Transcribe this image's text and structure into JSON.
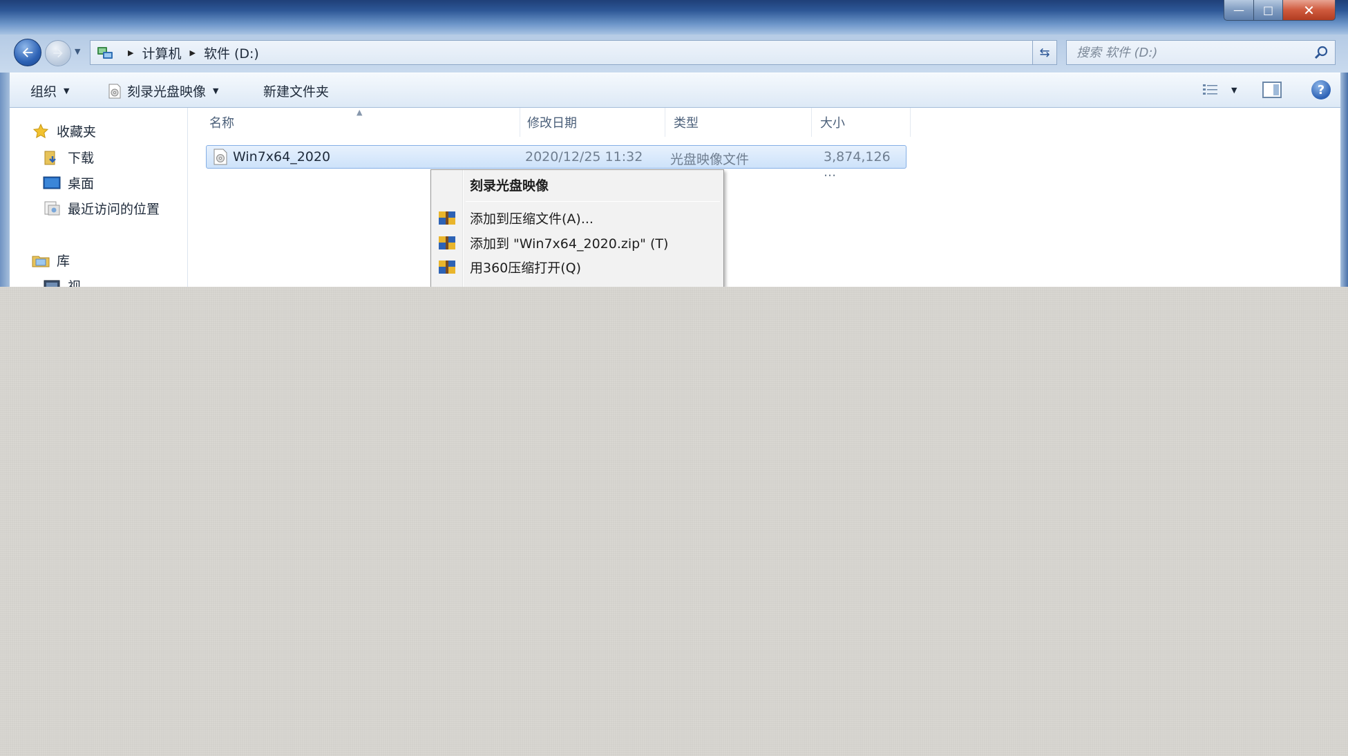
{
  "window": {
    "controls": {
      "minimize": "—",
      "maximize": "□",
      "close": "✕"
    }
  },
  "address": {
    "crumbs": [
      "计算机",
      "软件 (D:)"
    ],
    "search_placeholder": "搜索 软件 (D:)"
  },
  "toolbar": {
    "organize": "组织",
    "burn": "刻录光盘映像",
    "new_folder": "新建文件夹",
    "help": "?"
  },
  "nav": {
    "favorites": "收藏夹",
    "downloads": "下载",
    "desktop": "桌面",
    "recent": "最近访问的位置",
    "libraries": "库",
    "video_partial": "视"
  },
  "columns": {
    "name": "名称",
    "date": "修改日期",
    "type": "类型",
    "size": "大小"
  },
  "file": {
    "name": "Win7x64_2020",
    "date": "2020/12/25 11:32",
    "type": "光盘映像文件",
    "size": "3,874,126 ..."
  },
  "context_menu": {
    "burn": "刻录光盘映像",
    "add_archive": "添加到压缩文件(A)...",
    "add_zip": "添加到 \"Win7x64_2020.zip\" (T)",
    "open_360": "用360压缩打开(Q)"
  },
  "colors": {
    "title_gradient_top": "#1f3f78",
    "selection_fill": "#cde2fa",
    "selection_border": "#84aee5",
    "close_button": "#cf5a3d",
    "desktop_background": "#d3d1cc"
  }
}
